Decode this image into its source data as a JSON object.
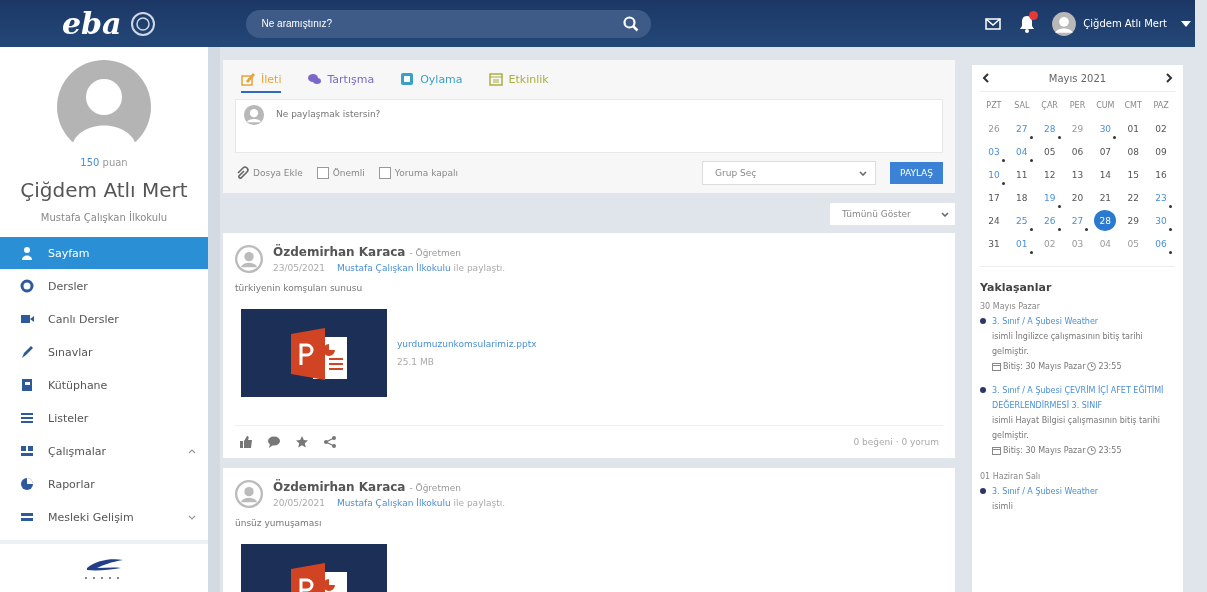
{
  "header": {
    "logo": "eba",
    "search": {
      "placeholder": "Ne aramıştınız?"
    },
    "user_name": "Çiğdem Atlı Mert",
    "notification_badge": true
  },
  "profile": {
    "points": "150",
    "points_label": "puan",
    "name": "Çiğdem Atlı Mert",
    "school": "Mustafa Çalışkan İlkokulu"
  },
  "sidebar": {
    "items": [
      {
        "label": "Sayfam",
        "kind": "link",
        "selected": true
      },
      {
        "label": "Dersler",
        "kind": "link",
        "selected": false
      },
      {
        "label": "Canlı Dersler",
        "kind": "link",
        "selected": false
      },
      {
        "label": "Sınavlar",
        "kind": "link",
        "selected": false
      },
      {
        "label": "Kütüphane",
        "kind": "link",
        "selected": false
      },
      {
        "label": "Listeler",
        "kind": "link",
        "selected": false
      },
      {
        "label": "Çalışmalar",
        "kind": "group",
        "selected": false,
        "expanded": true
      },
      {
        "label": "Raporlar",
        "kind": "link",
        "selected": false
      },
      {
        "label": "Mesleki Gelişim",
        "kind": "group",
        "selected": false,
        "expanded": false
      }
    ]
  },
  "composer": {
    "tabs": [
      {
        "label": "İleti",
        "color": "#e8a33a",
        "selected": true
      },
      {
        "label": "Tartışma",
        "color": "#7b68c9",
        "selected": false
      },
      {
        "label": "Oylama",
        "color": "#3aa0c8",
        "selected": false
      },
      {
        "label": "Etkinlik",
        "color": "#a8b040",
        "selected": false
      }
    ],
    "placeholder": "Ne paylaşmak istersin?",
    "attach": "Dosya Ekle",
    "options": [
      {
        "label": "Önemli",
        "checked": false
      },
      {
        "label": "Yoruma kapalı",
        "checked": false
      }
    ],
    "group_select": "Grup Seç",
    "share_button": "PAYLAŞ"
  },
  "filter": "Tümünü Göster",
  "posts": [
    {
      "author": "Özdemirhan Karaca",
      "role": "- Öğretmen",
      "date": "23/05/2021",
      "group": "Mustafa Çalışkan İlkokulu",
      "shared": "ile paylaştı.",
      "text": "türkiyenin komşuları sunusu",
      "file": {
        "name": "yurdumuzunkomsularimiz.pptx",
        "size": "25.1 MB"
      },
      "stats": "0 beğeni · 0 yorum"
    },
    {
      "author": "Özdemirhan Karaca",
      "role": "- Öğretmen",
      "date": "20/05/2021",
      "group": "Mustafa Çalışkan İlkokulu",
      "shared": "ile paylaştı.",
      "text": "ünsüz yumuşaması"
    }
  ],
  "calendar": {
    "month": "Mayıs 2021",
    "weekdays": [
      "PZT",
      "SAL",
      "ÇAR",
      "PER",
      "CUM",
      "CMT",
      "PAZ"
    ],
    "days": [
      {
        "day": "26",
        "in_month": false,
        "event": false,
        "selected": false
      },
      {
        "day": "27",
        "in_month": false,
        "event": true,
        "selected": false
      },
      {
        "day": "28",
        "in_month": false,
        "event": true,
        "selected": false
      },
      {
        "day": "29",
        "in_month": false,
        "event": false,
        "selected": false
      },
      {
        "day": "30",
        "in_month": false,
        "event": true,
        "selected": false
      },
      {
        "day": "01",
        "in_month": true,
        "event": false,
        "selected": false
      },
      {
        "day": "02",
        "in_month": true,
        "event": false,
        "selected": false
      },
      {
        "day": "03",
        "in_month": true,
        "event": true,
        "selected": false
      },
      {
        "day": "04",
        "in_month": true,
        "event": true,
        "selected": false
      },
      {
        "day": "05",
        "in_month": true,
        "event": false,
        "selected": false
      },
      {
        "day": "06",
        "in_month": true,
        "event": false,
        "selected": false
      },
      {
        "day": "07",
        "in_month": true,
        "event": false,
        "selected": false
      },
      {
        "day": "08",
        "in_month": true,
        "event": false,
        "selected": false
      },
      {
        "day": "09",
        "in_month": true,
        "event": false,
        "selected": false
      },
      {
        "day": "10",
        "in_month": true,
        "event": true,
        "selected": false
      },
      {
        "day": "11",
        "in_month": true,
        "event": false,
        "selected": false
      },
      {
        "day": "12",
        "in_month": true,
        "event": false,
        "selected": false
      },
      {
        "day": "13",
        "in_month": true,
        "event": false,
        "selected": false
      },
      {
        "day": "14",
        "in_month": true,
        "event": false,
        "selected": false
      },
      {
        "day": "15",
        "in_month": true,
        "event": false,
        "selected": false
      },
      {
        "day": "16",
        "in_month": true,
        "event": false,
        "selected": false
      },
      {
        "day": "17",
        "in_month": true,
        "event": false,
        "selected": false
      },
      {
        "day": "18",
        "in_month": true,
        "event": false,
        "selected": false
      },
      {
        "day": "19",
        "in_month": true,
        "event": true,
        "selected": false
      },
      {
        "day": "20",
        "in_month": true,
        "event": false,
        "selected": false
      },
      {
        "day": "21",
        "in_month": true,
        "event": false,
        "selected": false
      },
      {
        "day": "22",
        "in_month": true,
        "event": false,
        "selected": false
      },
      {
        "day": "23",
        "in_month": true,
        "event": true,
        "selected": false
      },
      {
        "day": "24",
        "in_month": true,
        "event": false,
        "selected": false
      },
      {
        "day": "25",
        "in_month": true,
        "event": true,
        "selected": false
      },
      {
        "day": "26",
        "in_month": true,
        "event": true,
        "selected": false
      },
      {
        "day": "27",
        "in_month": true,
        "event": true,
        "selected": false
      },
      {
        "day": "28",
        "in_month": true,
        "event": false,
        "selected": true
      },
      {
        "day": "29",
        "in_month": true,
        "event": false,
        "selected": false
      },
      {
        "day": "30",
        "in_month": true,
        "event": true,
        "selected": false
      },
      {
        "day": "31",
        "in_month": true,
        "event": false,
        "selected": false
      },
      {
        "day": "01",
        "in_month": false,
        "event": true,
        "selected": false
      },
      {
        "day": "02",
        "in_month": false,
        "event": false,
        "selected": false
      },
      {
        "day": "03",
        "in_month": false,
        "event": false,
        "selected": false
      },
      {
        "day": "04",
        "in_month": false,
        "event": false,
        "selected": false
      },
      {
        "day": "05",
        "in_month": false,
        "event": false,
        "selected": false
      },
      {
        "day": "06",
        "in_month": false,
        "event": true,
        "selected": false
      }
    ]
  },
  "upcoming": {
    "title": "Yaklaşanlar",
    "groups": [
      {
        "date": "30 Mayıs Pazar",
        "items": [
          {
            "link": "3. Sınıf / A Şubesi Weather",
            "text": "isimli İngilizce çalışmasının bitiş tarihi gelmiştir.",
            "deadline": "Bitiş: 30 Mayıs Pazar",
            "time": "23:55"
          },
          {
            "link": "3. Sınıf / A Şubesi ÇEVRİM İÇİ AFET EĞİTİMİ DEĞERLENDİRMESİ 3. SINIF",
            "text": "isimli Hayat Bilgisi çalışmasının bitiş tarihi gelmiştir.",
            "deadline": "Bitiş: 30 Mayıs Pazar",
            "time": "23:55"
          }
        ]
      },
      {
        "date": "01 Haziran Salı",
        "items": [
          {
            "link": "3. Sınıf / A Şubesi Weather",
            "text": "isimli"
          }
        ]
      }
    ]
  }
}
